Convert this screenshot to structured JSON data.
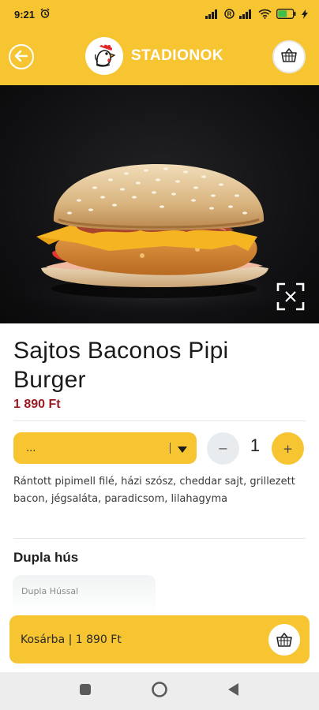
{
  "status_bar": {
    "time": "9:21",
    "battery_level": 0.6
  },
  "header": {
    "brand_name": "STADIONOK"
  },
  "product": {
    "title": "Sajtos Baconos Pipi Burger",
    "price": "1 890 Ft",
    "description": "Rántott pipimell filé, házi szósz, cheddar sajt, grillezett bacon, jégsaláta, paradicsom, lilahagyma"
  },
  "variant_select": {
    "value": "..."
  },
  "quantity": {
    "minus_label": "−",
    "value": "1",
    "plus_label": "+"
  },
  "extras": {
    "section_title": "Dupla hús",
    "option_label": "Dupla Hússal"
  },
  "cart_button": {
    "label": "Kosárba | 1 890 Ft"
  },
  "colors": {
    "accent": "#f7c531",
    "price": "#9c1b23"
  }
}
